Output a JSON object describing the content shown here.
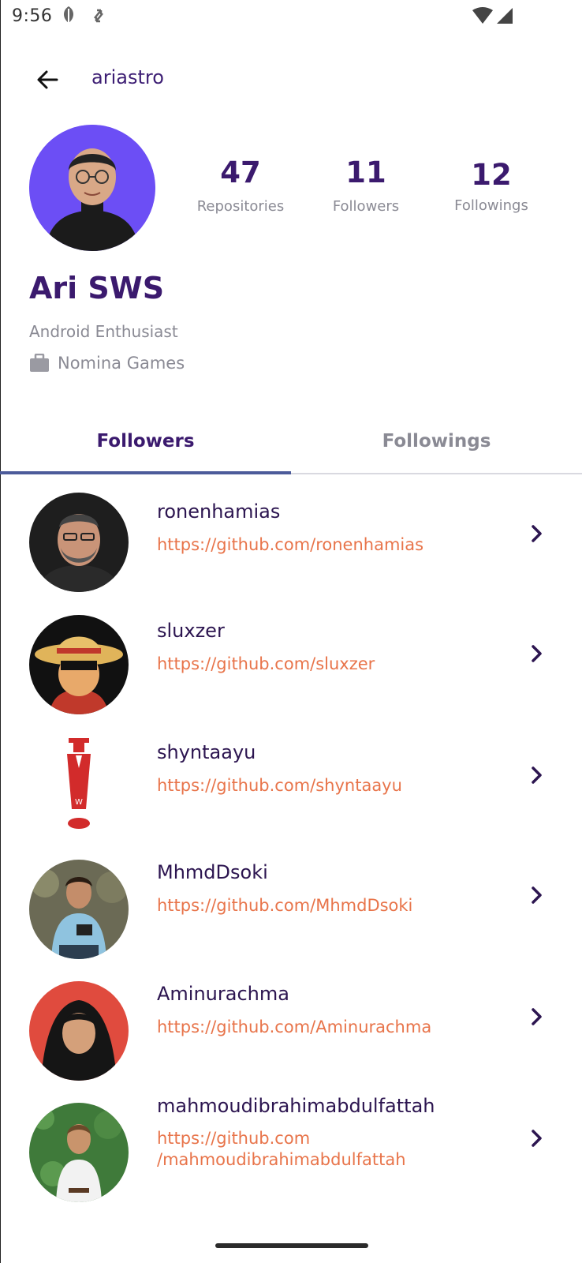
{
  "status_bar": {
    "time": "9:56"
  },
  "app_bar": {
    "title": "ariastro"
  },
  "profile": {
    "name": "Ari SWS",
    "bio": "Android Enthusiast",
    "company": "Nomina Games",
    "stats": [
      {
        "value": "47",
        "label": "Repositories"
      },
      {
        "value": "11",
        "label": "Followers"
      },
      {
        "value": "12",
        "label": "Followings"
      }
    ]
  },
  "tabs": [
    {
      "label": "Followers",
      "active": true
    },
    {
      "label": "Followings",
      "active": false
    }
  ],
  "followers": [
    {
      "login": "ronenhamias",
      "url": "https://github.com/ronenhamias"
    },
    {
      "login": "sluxzer",
      "url": "https://github.com/sluxzer"
    },
    {
      "login": "shyntaayu",
      "url": "https://github.com/shyntaayu"
    },
    {
      "login": "MhmdDsoki",
      "url": "https://github.com/MhmdDsoki"
    },
    {
      "login": "Aminurachma",
      "url": "https://github.com/Aminurachma"
    },
    {
      "login": "mahmoudibrahimabdulfattah",
      "url": "https://github.com\n/mahmoudibrahimabdulfattah"
    }
  ],
  "colors": {
    "primary": "#3b1a6e",
    "accent_link": "#e8744a",
    "muted": "#8a8a94",
    "tab_indicator": "#4c5b9a",
    "avatar_bg": "#6c4ef5"
  }
}
